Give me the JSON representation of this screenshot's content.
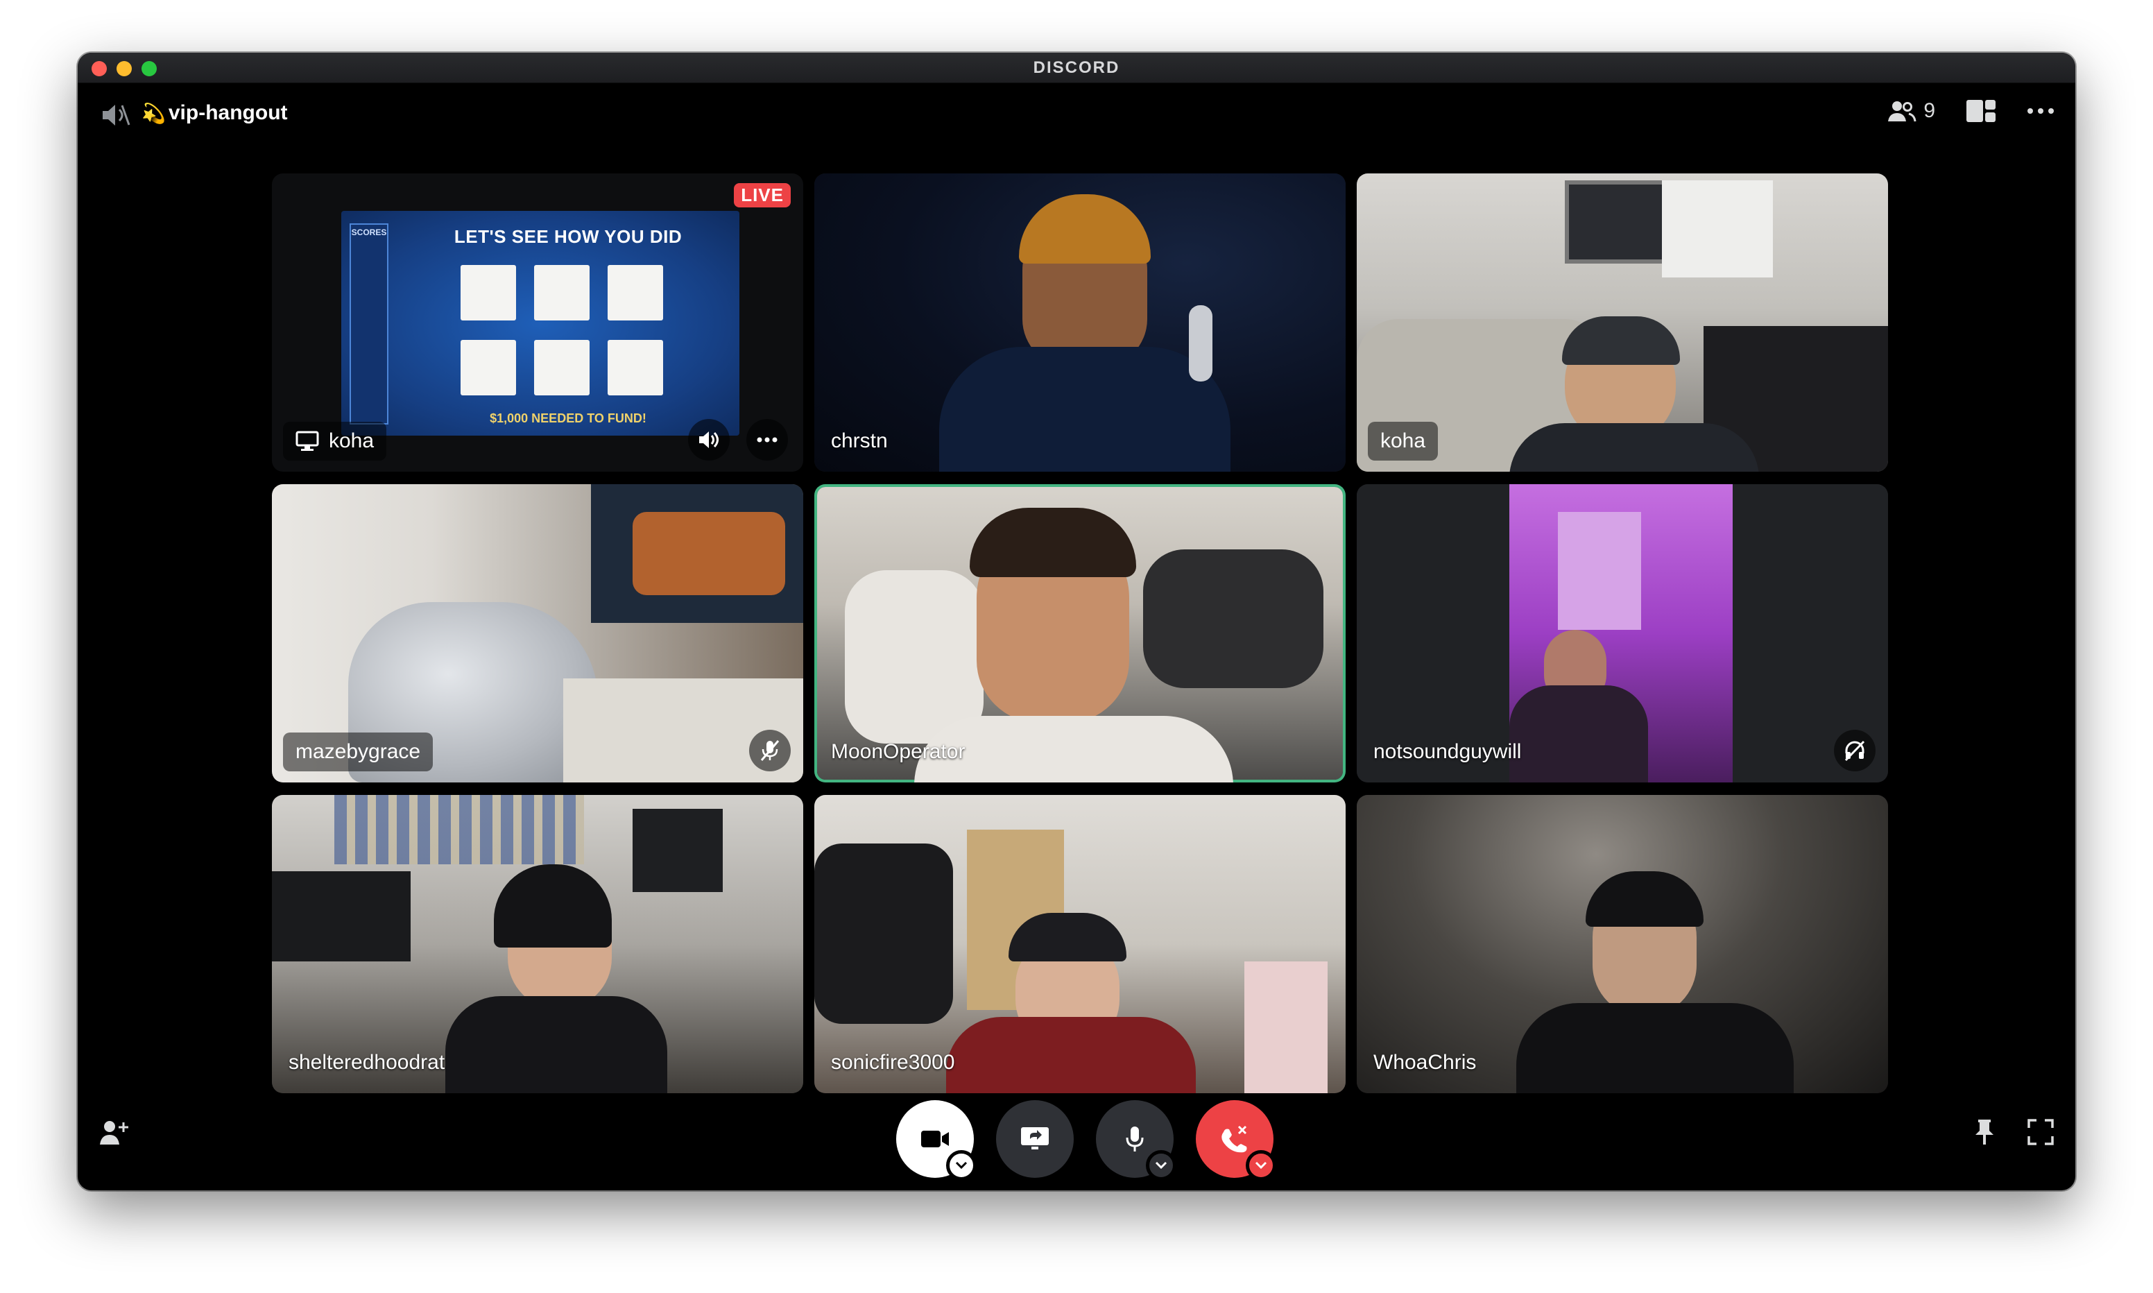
{
  "window": {
    "brand": "DISCORD"
  },
  "channel": {
    "prefix": "💫",
    "name": "vip-hangout"
  },
  "toolbar": {
    "member_count": "9"
  },
  "stream": {
    "live_label": "LIVE",
    "owner": "koha"
  },
  "game": {
    "title": "LET'S SEE HOW YOU DID",
    "footer": "$1,000 NEEDED TO FUND!",
    "scores_label": "SCORES"
  },
  "participants": [
    {
      "name": "chrstn"
    },
    {
      "name": "koha"
    },
    {
      "name": "mazebygrace",
      "status": "muted"
    },
    {
      "name": "MoonOperator",
      "speaking": true
    },
    {
      "name": "notsoundguywill",
      "status": "deafened"
    },
    {
      "name": "shelteredhoodrat"
    },
    {
      "name": "sonicfire3000"
    },
    {
      "name": "WhoaChris"
    }
  ],
  "colors": {
    "speaking": "#43b581",
    "live": "#ed4245",
    "hangup": "#ed4245",
    "background": "#000000"
  },
  "icons": [
    "speaker-off-icon",
    "members-icon",
    "layout-icon",
    "more-icon",
    "monitor-icon",
    "volume-icon",
    "mute-icon",
    "deafen-icon",
    "camera-icon",
    "screen-share-icon",
    "microphone-icon",
    "hangup-icon",
    "add-friend-icon",
    "pin-icon",
    "fullscreen-icon"
  ]
}
